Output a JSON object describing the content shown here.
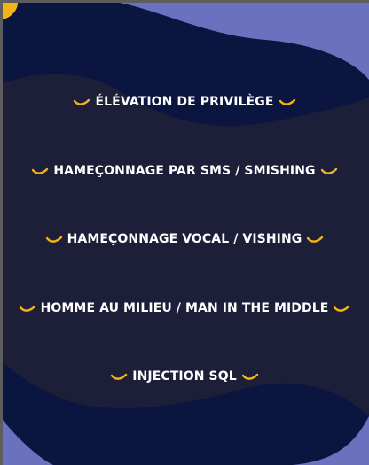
{
  "colors": {
    "background_blue": "#6a72c0",
    "dark_navy": "#0b1640",
    "dark_overlay": "#1d1e38",
    "accent_yellow": "#f2b418",
    "text": "#ffffff"
  },
  "items": [
    {
      "label": "ÉLÉVATION DE PRIVILÈGE",
      "icon": "wave-icon"
    },
    {
      "label": "HAMEÇONNAGE PAR SMS / SMISHING",
      "icon": "wave-icon"
    },
    {
      "label": "HAMEÇONNAGE VOCAL / VISHING",
      "icon": "wave-icon"
    },
    {
      "label": "HOMME AU MILIEU / MAN IN THE MIDDLE",
      "icon": "wave-icon"
    },
    {
      "label": "INJECTION SQL",
      "icon": "wave-icon"
    }
  ]
}
